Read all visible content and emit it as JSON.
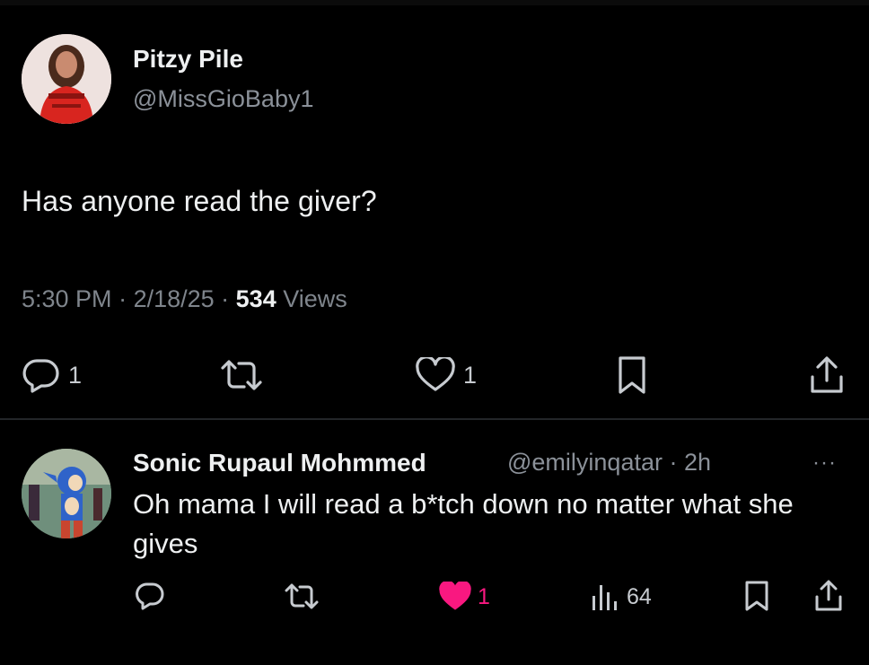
{
  "tweet": {
    "author_name": "Pitzy Pile",
    "author_handle": "@MissGioBaby1",
    "text": "Has anyone read the giver?",
    "time": "5:30 PM",
    "separator": " · ",
    "date": "2/18/25",
    "views_count": "534",
    "views_label": " Views",
    "reply_count": "1",
    "like_count": "1"
  },
  "reply": {
    "author_name": "Sonic Rupaul Mohmmed",
    "author_handle": "@emilyinqatar",
    "separator": " · ",
    "age": "2h",
    "more": "···",
    "text": "Oh mama I will read a b*tch down no matter what she gives",
    "like_count": "1",
    "views_count": "64"
  },
  "colors": {
    "background": "#000000",
    "text": "#eef0f1",
    "secondary": "#8b9199",
    "like_active": "#f91880",
    "divider": "#232629"
  },
  "icons": [
    "reply-icon",
    "retweet-icon",
    "like-icon",
    "bookmark-icon",
    "share-icon",
    "views-icon",
    "more-icon"
  ]
}
